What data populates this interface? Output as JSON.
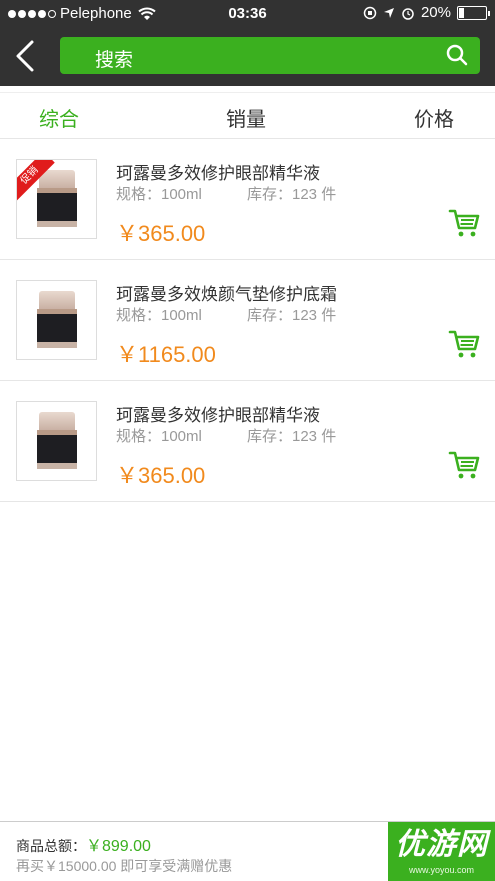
{
  "status_bar": {
    "carrier": "Pelephone",
    "time": "03:36",
    "battery": "20%",
    "battery_level": 0.2
  },
  "nav": {
    "back_icon": "chevron-left-icon",
    "search_label": "搜索",
    "search_icon": "search-icon"
  },
  "tabs": [
    {
      "label": "综合",
      "active": true
    },
    {
      "label": "销量",
      "active": false
    },
    {
      "label": "价格",
      "active": false
    }
  ],
  "products": [
    {
      "title": "珂露曼多效修护眼部精华液",
      "spec": "规格：100ml",
      "stock": "库存：123 件",
      "price": "￥365.00",
      "promo": "促销"
    },
    {
      "title": "珂露曼多效焕颜气垫修护底霜",
      "spec": "规格：100ml",
      "stock": "库存：123 件",
      "price": "￥1165.00"
    },
    {
      "title": "珂露曼多效修护眼部精华液",
      "spec": "规格：100ml",
      "stock": "库存：123 件",
      "price": "￥365.00"
    }
  ],
  "bottom": {
    "total_label": "商品总额：",
    "total_amount": "￥899.00",
    "promo_text": "再买￥15000.00 即可享受满赠优惠"
  },
  "watermark": {
    "main": "优游网",
    "url": "www.yoyou.com"
  },
  "colors": {
    "accent": "#3bb01f",
    "price": "#f18a1d",
    "header_bg": "#323232",
    "promo": "#e01c1c"
  }
}
